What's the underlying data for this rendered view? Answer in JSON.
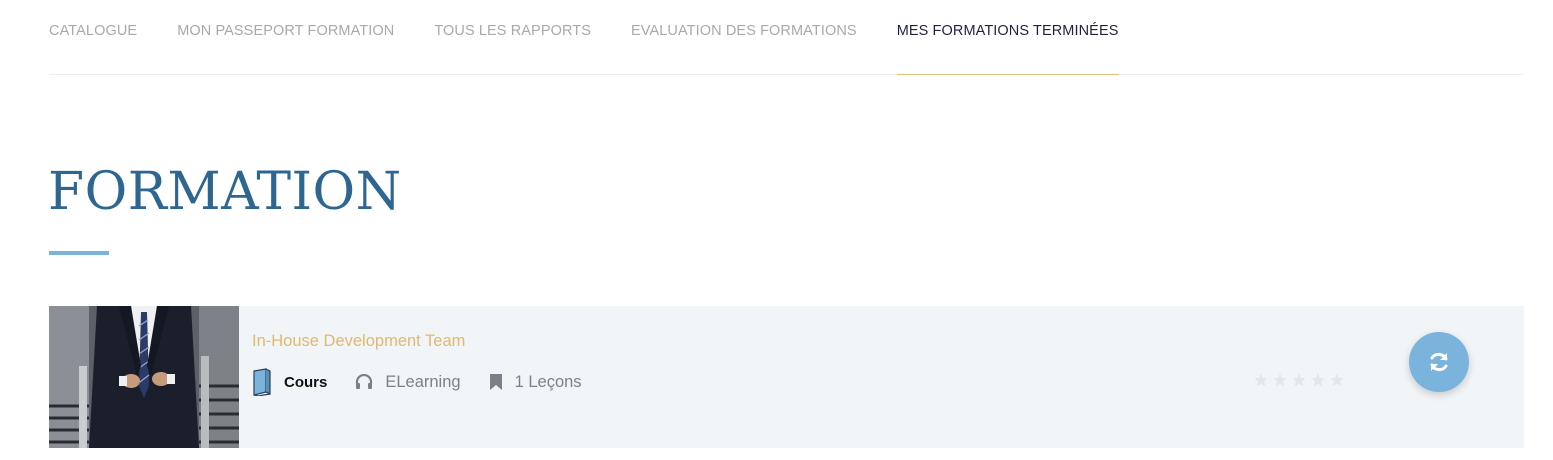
{
  "nav": {
    "tabs": [
      {
        "label": "CATALOGUE",
        "active": false
      },
      {
        "label": "MON PASSEPORT FORMATION",
        "active": false
      },
      {
        "label": "TOUS LES RAPPORTS",
        "active": false
      },
      {
        "label": "EVALUATION DES FORMATIONS",
        "active": false
      },
      {
        "label": "MES FORMATIONS TERMINÉES",
        "active": true
      }
    ]
  },
  "main": {
    "title": "FORMATION",
    "course": {
      "title": "In-House Development Team",
      "type_label": "Cours",
      "mode_label": "ELearning",
      "lessons_label": "1 Leçons",
      "rating": 0,
      "rating_max": 5,
      "thumbnail_icon": "businessman-photo",
      "action_icon": "refresh-icon"
    }
  },
  "colors": {
    "title": "#2d6691",
    "accent_blue": "#7ab4dc",
    "accent_gold": "#e0b96c",
    "card_bg": "#f2f5f8"
  }
}
